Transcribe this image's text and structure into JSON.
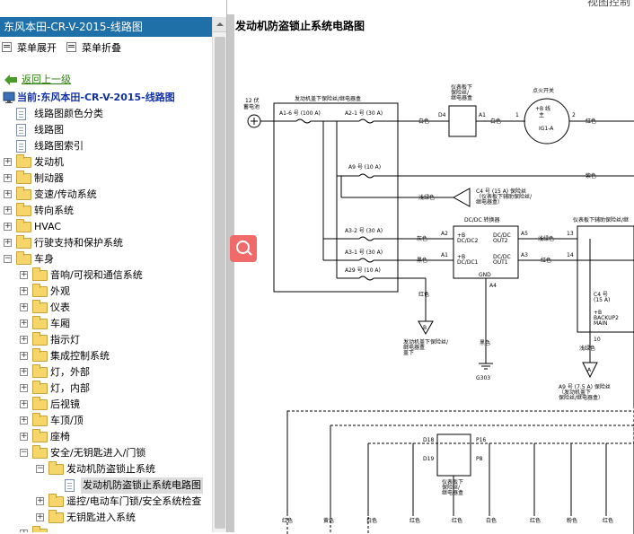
{
  "header": {
    "title": "东风本田-CR-V-2015-线路图",
    "view_control": "视图控制"
  },
  "menu": {
    "expand": "菜单展开",
    "collapse": "菜单折叠"
  },
  "tree": {
    "back": "返回上一级",
    "current": "当前:东风本田-CR-V-2015-线路图",
    "items": [
      "线路图颜色分类",
      "线路图",
      "线路图索引",
      "发动机",
      "制动器",
      "变速/传动系统",
      "转向系统",
      "HVAC",
      "行驶支持和保护系统",
      "车身",
      "音响/可视和通信系统",
      "外观",
      "仪表",
      "车厢",
      "指示灯",
      "集成控制系统",
      "灯，外部",
      "灯，内部",
      "后视镜",
      "车顶/顶",
      "座椅",
      "安全/无钥匙进入/门锁",
      "发动机防盗锁止系统",
      "发动机防盗锁止系统电路图",
      "遥控/电动车门锁/安全系统检查",
      "无钥匙进入系统"
    ]
  },
  "diagram": {
    "title": "发动机防盗锁止系统电路图",
    "labels": {
      "battery": "12 伏\n蓄电池",
      "fusebox": "发动机盖下保险丝/继电器盒",
      "a16": "A1-6 号 (100 A)",
      "a21": "A2-1 号 (30 A)",
      "a9": "A9 号 (10 A)",
      "a32": "A3-2 号 (30 A)",
      "a31": "A3-1 号 (30 A)",
      "a29": "A29 号 (10 A)",
      "d4": "D4",
      "a1": "A1",
      "dash_box": "仪表板下\n保险丝/\n继电器盒",
      "ignition": "点火开关",
      "sw_b": "+B 线\n主",
      "ig1a": "IG1-A",
      "pin1": "1",
      "pin2": "2",
      "red": "红色",
      "white": "白色",
      "purple": "紫色",
      "green": "浅绿色",
      "black": "黑色",
      "gray": "灰色",
      "c4": "C4 号 (15 A) 保险丝\n（仪表板下辅助保险丝/\n继电器盒）",
      "dcdc": "DC/DC 转换器",
      "a2": "A2",
      "a1b": "A1",
      "a5": "A5",
      "a3": "A3",
      "a4": "A4",
      "dc_in2": "+B\nDC/DC2",
      "dc_in1": "+B\nDC/DC1",
      "dc_out2": "DC/DC\nOUT2",
      "dc_out1": "DC/DC\nOUT1",
      "gnd": "GND",
      "n13": "13",
      "n14": "14",
      "n10": "10",
      "aux_box": "仪表板下辅助保险丝/继",
      "c4b": "C4 号\n(15 A)",
      "backup": "+B\nBACKUP2\nMAIN",
      "a9b": "A9 号 (7.5 A) 保险丝\n（发动机盖下\n保险丝/继电器盒）",
      "engine_fb": "发动机盖下保险丝/\n继电器盒\n盖下",
      "g303": "G303",
      "d18": "D18",
      "p16": "P16",
      "d19": "D19",
      "p8": "P8",
      "dash_box2": "仪表板下\n保险丝/\n继电器盒",
      "yellow": "黄色",
      "pink": "粉色",
      "bot_red": "红色"
    }
  }
}
